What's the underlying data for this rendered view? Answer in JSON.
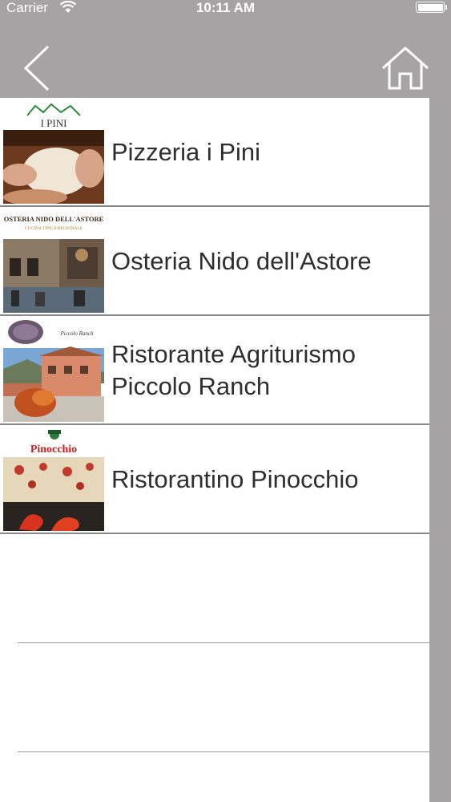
{
  "status_bar": {
    "carrier": "Carrier",
    "time": "10:11 AM"
  },
  "nav_bar": {
    "back_icon": "chevron-left-icon",
    "home_icon": "home-outline-icon"
  },
  "restaurants": [
    {
      "name": "Pizzeria i Pini",
      "logo_text": "I PINI"
    },
    {
      "name": "Osteria Nido dell'Astore",
      "logo_text": "OSTERIA NIDO DELL'ASTORE",
      "logo_subtext": "CUCINA TIPICA REGIONALE"
    },
    {
      "name": "Ristorante Agriturismo Piccolo Ranch",
      "logo_text": "Piccolo Ranch"
    },
    {
      "name": "Ristorantino Pinocchio",
      "logo_text": "Pinocchio"
    }
  ],
  "colors": {
    "nav_background": "#a7a3a4",
    "list_background": "#ffffff",
    "text": "#2e2e2e",
    "divider": "#8a8a8a"
  }
}
